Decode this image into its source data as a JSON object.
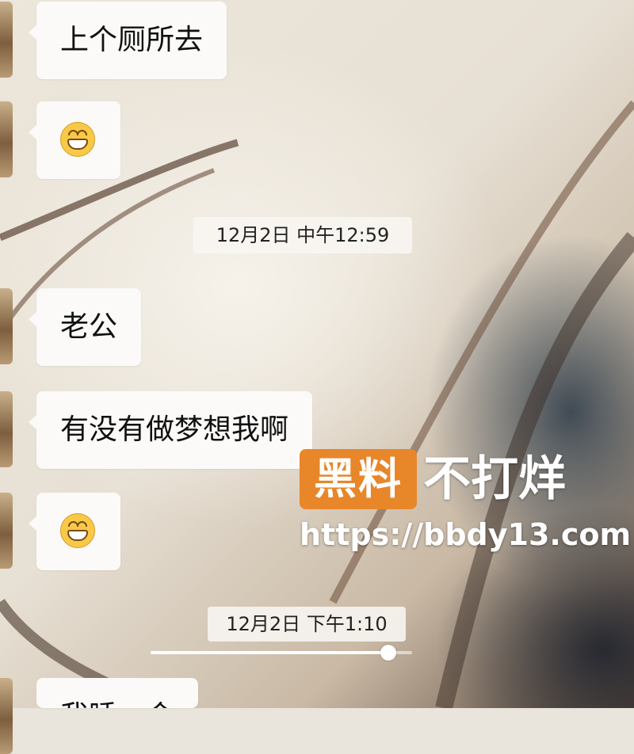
{
  "messages": [
    {
      "type": "text",
      "text": "上个厕所去"
    },
    {
      "type": "emoji",
      "emoji": "grinning-face"
    },
    {
      "type": "text",
      "text": "老公"
    },
    {
      "type": "text",
      "text": "有没有做梦想我啊"
    },
    {
      "type": "emoji",
      "emoji": "grinning-face"
    },
    {
      "type": "text",
      "text": "我睡一会"
    }
  ],
  "timestamps": [
    "12月2日 中午12:59",
    "12月2日 下午1:10"
  ],
  "watermark": {
    "badge": "黑料",
    "tagline": "不打烊",
    "url": "https://bbdy13.com",
    "badge_color": "#e8862a"
  },
  "video_progress": {
    "played_fraction": 0.91
  }
}
